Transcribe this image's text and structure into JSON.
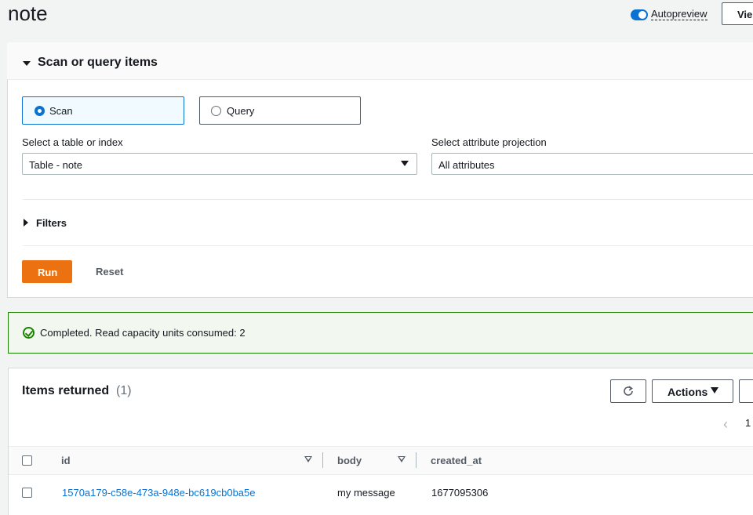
{
  "header": {
    "title": "note",
    "autopreview_label": "Autopreview",
    "view_button_label": "Vie"
  },
  "scan_panel": {
    "title": "Scan or query items",
    "options": [
      {
        "label": "Scan",
        "selected": true
      },
      {
        "label": "Query",
        "selected": false
      }
    ],
    "table_label": "Select a table or index",
    "table_value": "Table - note",
    "projection_label": "Select attribute projection",
    "projection_value": "All attributes",
    "filters_label": "Filters",
    "run_label": "Run",
    "reset_label": "Reset"
  },
  "alert": {
    "message": "Completed. Read capacity units consumed: 2"
  },
  "items": {
    "title": "Items returned",
    "count": "(1)",
    "actions_label": "Actions",
    "page_number": "1",
    "columns": [
      "id",
      "body",
      "created_at"
    ],
    "rows": [
      {
        "id": "1570a179-c58e-473a-948e-bc619cb0ba5e",
        "body": "my message",
        "created_at": "1677095306"
      }
    ]
  },
  "colors": {
    "accent": "#0972d3",
    "run_button": "#ec7211",
    "success": "#1d8102"
  }
}
